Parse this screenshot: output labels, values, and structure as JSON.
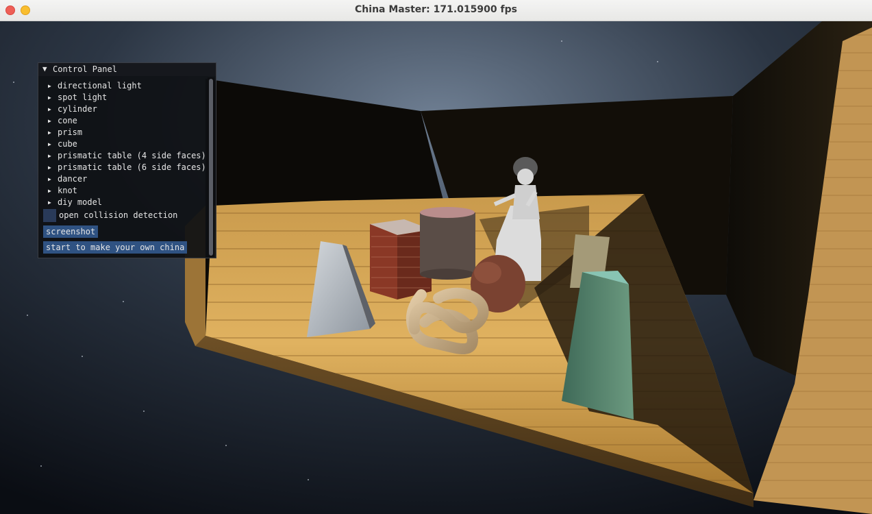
{
  "window": {
    "title": "China Master: 171.015900 fps"
  },
  "panel": {
    "title": "Control Panel",
    "items": [
      {
        "label": "directional light"
      },
      {
        "label": "spot light"
      },
      {
        "label": "cylinder"
      },
      {
        "label": "cone"
      },
      {
        "label": "prism"
      },
      {
        "label": "cube"
      },
      {
        "label": "prismatic table (4 side faces)"
      },
      {
        "label": "prismatic table (6 side faces)"
      },
      {
        "label": "dancer"
      },
      {
        "label": "knot"
      },
      {
        "label": "diy model"
      }
    ],
    "collision_label": "open collision detection",
    "collision_checked": false,
    "screenshot_button": "screenshot",
    "make_china_button": "start to make your own china"
  },
  "scene": {
    "objects": [
      "wooden room",
      "marble prismatic table",
      "brick cube",
      "cylinder",
      "dancer",
      "knot",
      "cone",
      "prism",
      "green prismatic table"
    ]
  }
}
